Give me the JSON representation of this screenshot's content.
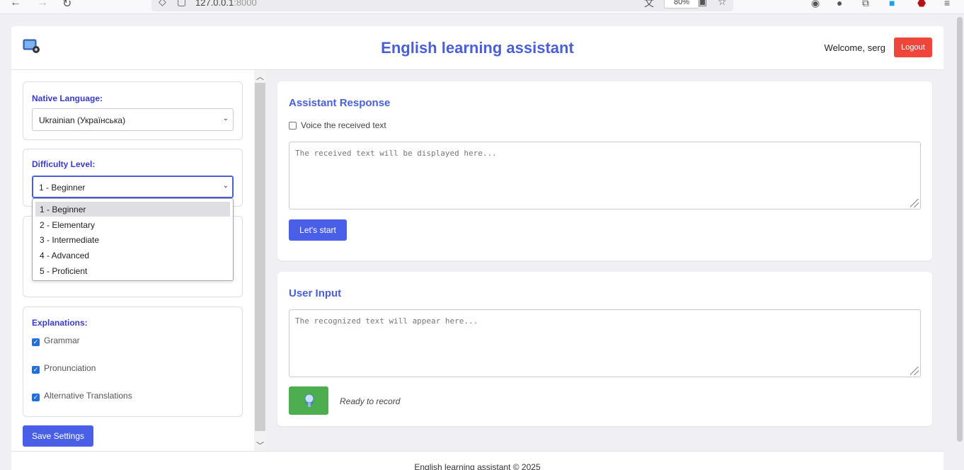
{
  "browser": {
    "url_host": "127.0.0.1",
    "url_port": ":8000",
    "zoom": "80%"
  },
  "header": {
    "title": "English learning assistant",
    "welcome": "Welcome, serg",
    "logout_label": "Logout"
  },
  "sidebar": {
    "native_language": {
      "label": "Native Language:",
      "value": "Ukrainian (Українська)"
    },
    "difficulty": {
      "label": "Difficulty Level:",
      "value": "1 - Beginner",
      "options": [
        "1 - Beginner",
        "2 - Elementary",
        "3 - Intermediate",
        "4 - Advanced",
        "5 - Proficient"
      ]
    },
    "explanations": {
      "label": "Explanations:",
      "items": [
        {
          "label": "Grammar",
          "checked": true
        },
        {
          "label": "Pronunciation",
          "checked": true
        },
        {
          "label": "Alternative Translations",
          "checked": true
        }
      ]
    },
    "save_label": "Save Settings"
  },
  "assistant": {
    "title": "Assistant Response",
    "voice_label": "Voice the received text",
    "placeholder": "The received text will be displayed here...",
    "start_label": "Let's start"
  },
  "user_input": {
    "title": "User Input",
    "placeholder": "The recognized text will appear here...",
    "status": "Ready to record"
  },
  "footer": {
    "text": "English learning assistant © 2025"
  },
  "colors": {
    "accent": "#4a5fd6",
    "button_blue": "#4a5fe8",
    "logout_red": "#f0453a",
    "mic_green": "#4cae4c"
  }
}
